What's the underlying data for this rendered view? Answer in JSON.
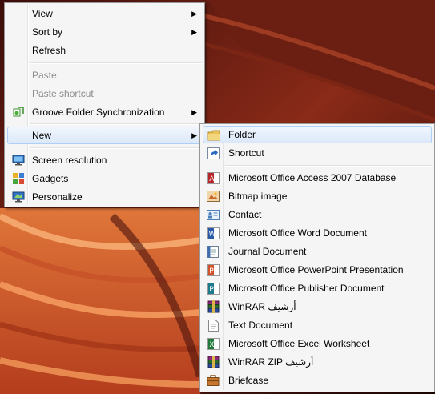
{
  "context_menu": {
    "view": "View",
    "sort_by": "Sort by",
    "refresh": "Refresh",
    "paste": "Paste",
    "paste_shortcut": "Paste shortcut",
    "groove": "Groove Folder Synchronization",
    "new": "New",
    "screen_resolution": "Screen resolution",
    "gadgets": "Gadgets",
    "personalize": "Personalize"
  },
  "new_submenu": {
    "folder": "Folder",
    "shortcut": "Shortcut",
    "access": "Microsoft Office Access 2007 Database",
    "bitmap": "Bitmap image",
    "contact": "Contact",
    "word": "Microsoft Office Word Document",
    "journal": "Journal Document",
    "powerpoint": "Microsoft Office PowerPoint Presentation",
    "publisher": "Microsoft Office Publisher Document",
    "winrar": "WinRAR أرشيف",
    "text": "Text Document",
    "excel": "Microsoft Office Excel Worksheet",
    "winrar_zip": "WinRAR ZIP أرشيف",
    "briefcase": "Briefcase"
  },
  "arrow_glyph": "▶",
  "colors": {
    "highlight_border": "#aecff7",
    "menu_bg": "#f5f5f5",
    "disabled_text": "#8d8d8d"
  }
}
